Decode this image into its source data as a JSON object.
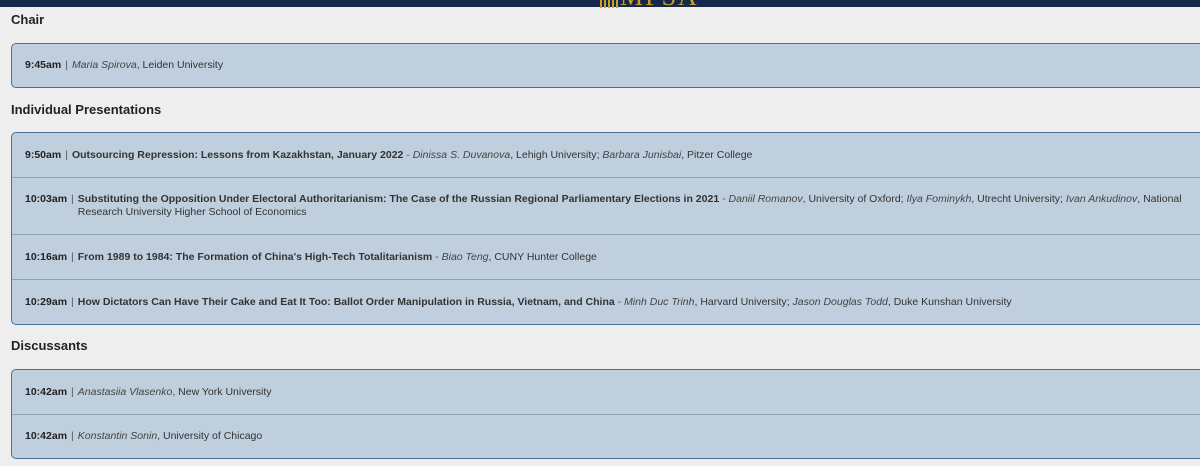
{
  "logo_text": "MPSA",
  "sections": {
    "chair": {
      "heading": "Chair",
      "rows": [
        {
          "time": "9:45am",
          "title": "",
          "people": [
            {
              "name": "Maria Spirova",
              "affiliation": "Leiden University"
            }
          ]
        }
      ]
    },
    "presentations": {
      "heading": "Individual Presentations",
      "rows": [
        {
          "time": "9:50am",
          "title": "Outsourcing Repression: Lessons from Kazakhstan, January 2022",
          "people": [
            {
              "name": "Dinissa S. Duvanova",
              "affiliation": "Lehigh University"
            },
            {
              "name": "Barbara Junisbai",
              "affiliation": "Pitzer College"
            }
          ]
        },
        {
          "time": "10:03am",
          "title": "Substituting the Opposition Under Electoral Authoritarianism: The Case of the Russian Regional Parliamentary Elections in 2021",
          "people": [
            {
              "name": "Daniil Romanov",
              "affiliation": "University of Oxford"
            },
            {
              "name": "Ilya Fominykh",
              "affiliation": "Utrecht University"
            },
            {
              "name": "Ivan Ankudinov",
              "affiliation": "National Research University Higher School of Economics"
            }
          ]
        },
        {
          "time": "10:16am",
          "title": "From 1989 to 1984: The Formation of China's High-Tech Totalitarianism",
          "people": [
            {
              "name": "Biao Teng",
              "affiliation": "CUNY Hunter College"
            }
          ]
        },
        {
          "time": "10:29am",
          "title": "How Dictators Can Have Their Cake and Eat It Too: Ballot Order Manipulation in Russia, Vietnam, and China",
          "people": [
            {
              "name": "Minh Duc Trinh",
              "affiliation": "Harvard University"
            },
            {
              "name": "Jason Douglas Todd",
              "affiliation": "Duke Kunshan University"
            }
          ]
        }
      ]
    },
    "discussants": {
      "heading": "Discussants",
      "rows": [
        {
          "time": "10:42am",
          "title": "",
          "people": [
            {
              "name": "Anastasiia Vlasenko",
              "affiliation": "New York University"
            }
          ]
        },
        {
          "time": "10:42am",
          "title": "",
          "people": [
            {
              "name": "Konstantin Sonin",
              "affiliation": "University of Chicago"
            }
          ]
        }
      ]
    }
  }
}
